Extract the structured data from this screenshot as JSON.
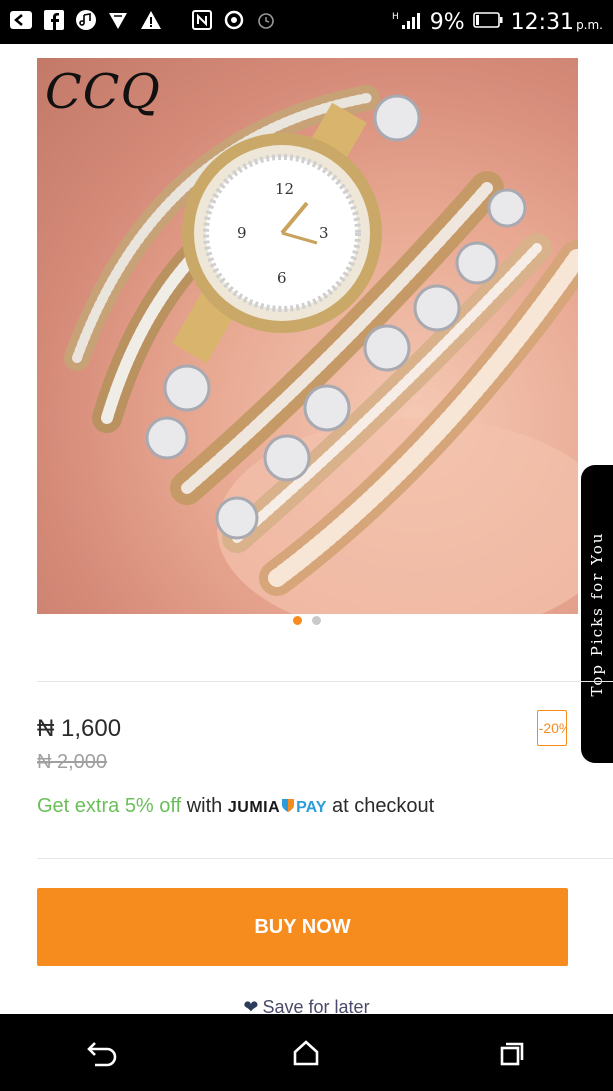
{
  "status_bar": {
    "battery_percent": "9%",
    "time": "12:31",
    "ampm": "p.m.",
    "icons": [
      "back-arrow-icon",
      "facebook-icon",
      "music-icon",
      "vpn-icon",
      "warning-icon",
      "nfc-icon",
      "data-saver-icon",
      "alarm-icon",
      "signal-icon",
      "battery-icon"
    ]
  },
  "product": {
    "brand_logo": "CCQ",
    "image_pages": 2,
    "active_page": 1,
    "price": "₦ 1,600",
    "old_price": "₦ 2,000",
    "discount": "-20%"
  },
  "promo": {
    "prefix": "Get extra 5% off",
    "with": "with",
    "brand": "JUMIA",
    "pay": "PAY",
    "suffix": "at checkout"
  },
  "top_picks": {
    "label": "Top Picks for You"
  },
  "actions": {
    "buy_now": "BUY NOW",
    "save_for_later": "Save for later"
  },
  "colors": {
    "accent": "#f68b1e",
    "promo_green": "#6bbf59",
    "pay_blue": "#2d9cdb"
  }
}
